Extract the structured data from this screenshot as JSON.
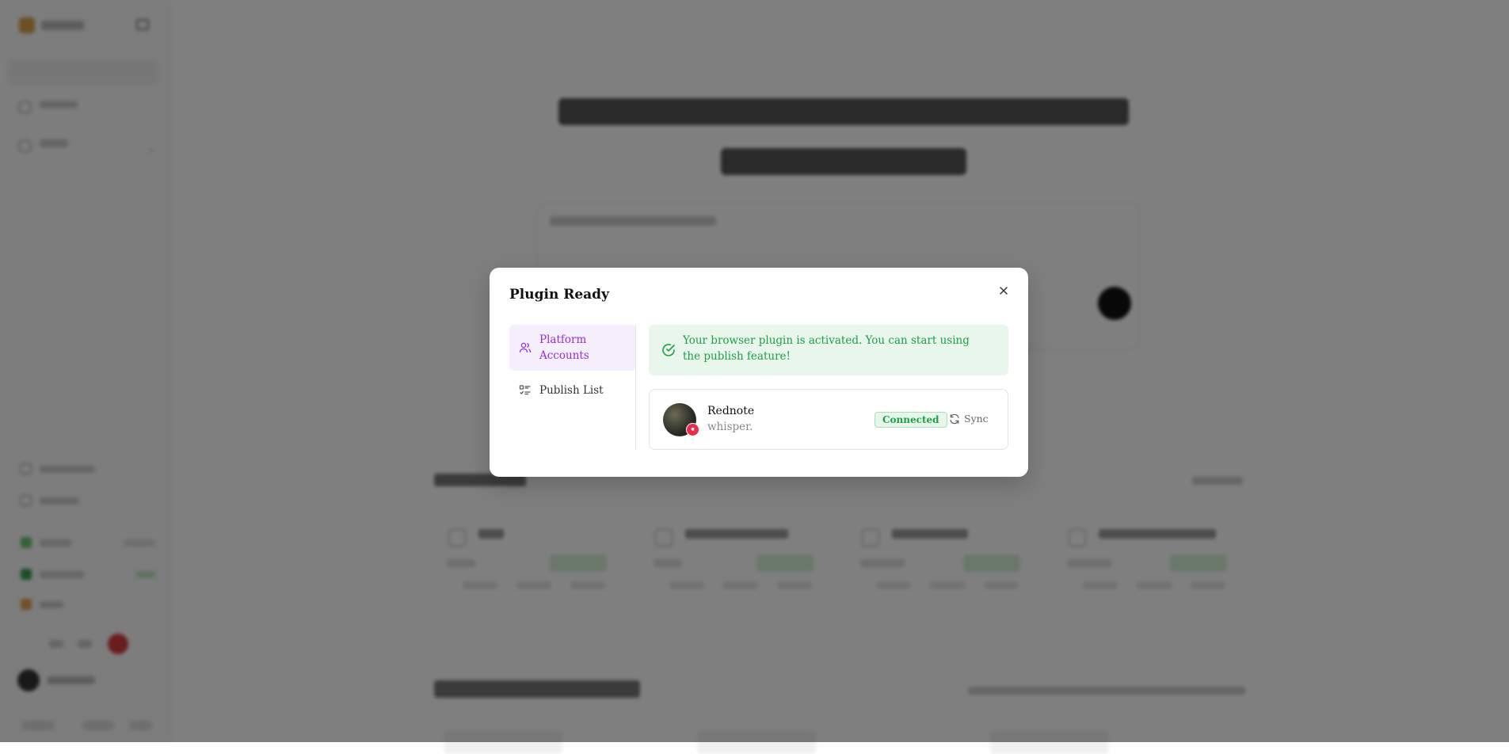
{
  "modal": {
    "title": "Plugin Ready",
    "nav": [
      {
        "label": "Platform Accounts",
        "icon": "users-icon",
        "active": true
      },
      {
        "label": "Publish List",
        "icon": "list-icon",
        "active": false
      }
    ],
    "alert": "Your browser plugin is activated. You can start using the publish feature!",
    "account": {
      "platform": "Rednote",
      "handle": "whisper.",
      "status": "Connected",
      "sync_label": "Sync"
    }
  },
  "colors": {
    "accent": "#9330d0",
    "success": "#1e9e45",
    "success_bg": "#e8f6ec",
    "badge": "#ee2a4a"
  }
}
